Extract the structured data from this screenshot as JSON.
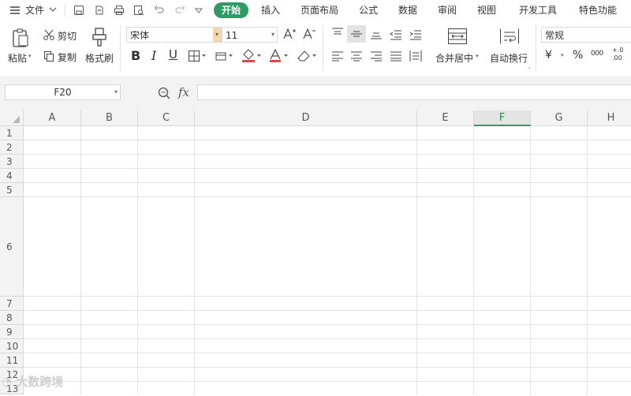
{
  "menubar": {
    "file_label": "文件",
    "tabs": [
      "开始",
      "插入",
      "页面布局",
      "公式",
      "数据",
      "审阅",
      "视图",
      "开发工具",
      "特色功能"
    ]
  },
  "ribbon": {
    "paste": "粘贴",
    "cut": "剪切",
    "copy": "复制",
    "format_painter": "格式刷",
    "font_name": "宋体",
    "font_size": "11",
    "bold": "B",
    "italic": "I",
    "underline": "U",
    "merge_center": "合并居中",
    "wrap_text": "自动换行",
    "number_format": "常规",
    "currency": "¥",
    "percent": "%",
    "thousands": "000",
    "increase_decimal": "+.0",
    "decrease_decimal": ".00"
  },
  "formula_bar": {
    "cell_ref": "F20",
    "fx": "fx",
    "value": ""
  },
  "grid": {
    "columns": [
      "A",
      "B",
      "C",
      "D",
      "E",
      "F",
      "G",
      "H"
    ],
    "selected_column": "F",
    "rows": [
      "1",
      "2",
      "3",
      "4",
      "5",
      "6",
      "7",
      "8",
      "9",
      "10",
      "11",
      "12",
      "13"
    ]
  },
  "watermark": "大数跨境",
  "colors": {
    "accent": "#2e9b63",
    "header_bg": "#f3f3f3",
    "grid_line": "#e3e3e3"
  }
}
